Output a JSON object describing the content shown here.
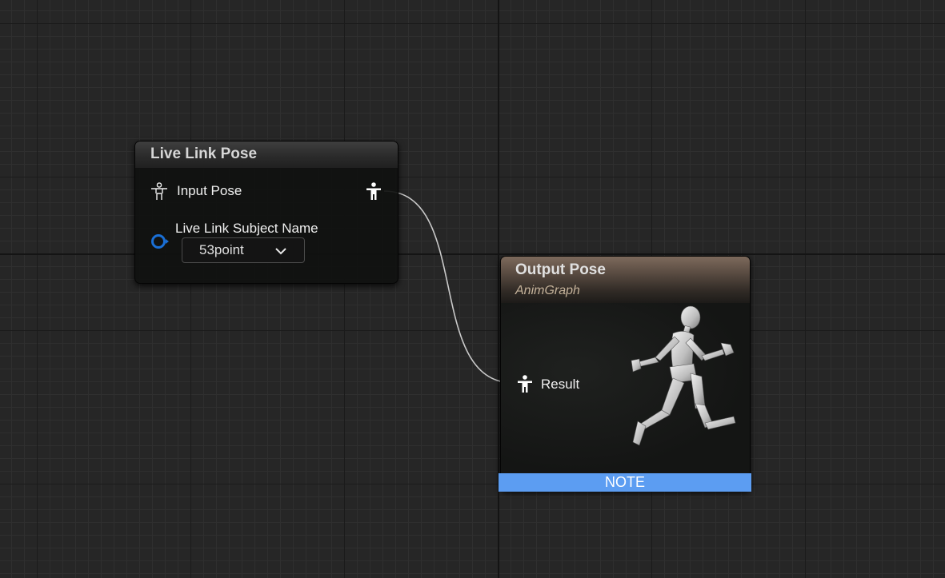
{
  "graph": {
    "name": "AnimGraph"
  },
  "live_link_node": {
    "title": "Live Link Pose",
    "input_pin_label": "Input Pose",
    "subject_pin_label": "Live Link Subject Name",
    "subject_value": "53point"
  },
  "output_node": {
    "title": "Output Pose",
    "subtitle": "AnimGraph",
    "result_pin_label": "Result",
    "note_label": "NOTE"
  },
  "colors": {
    "pose_pin": "#ffffff",
    "name_pin": "#1a6fd6",
    "note_bar": "#5c9df2",
    "output_header": "#8a7565"
  },
  "icons": {
    "pose_pin": "person-icon",
    "name_pin": "circle-pin-icon",
    "dropdown": "chevron-down-icon",
    "preview": "running-mannequin-icon"
  }
}
